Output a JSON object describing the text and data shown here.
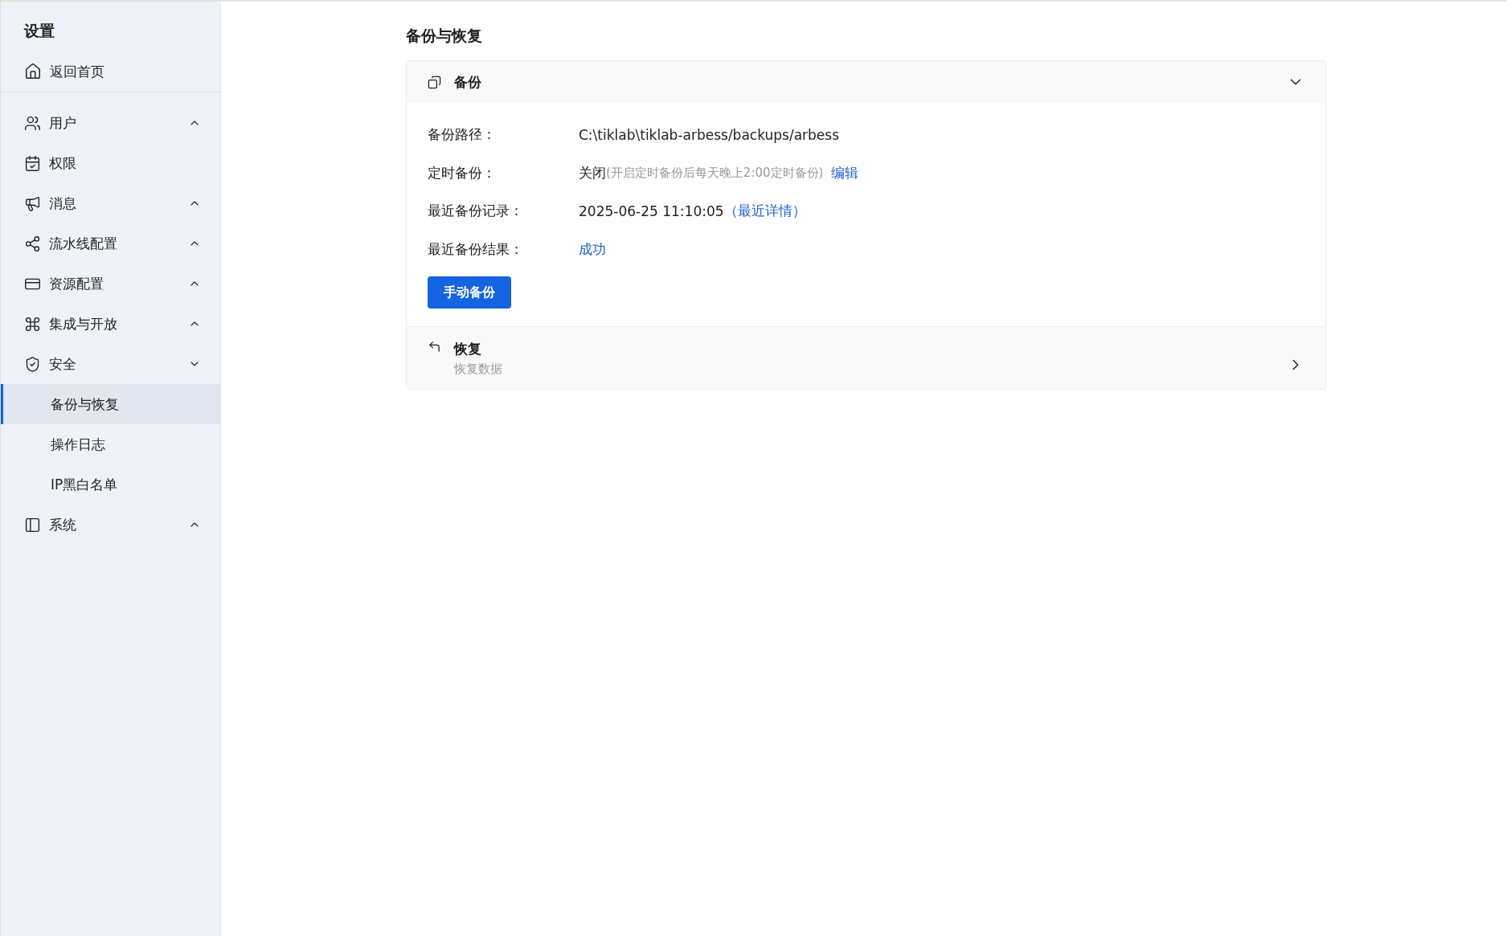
{
  "sidebar": {
    "title": "设置",
    "home": {
      "label": "返回首页"
    },
    "items": [
      {
        "label": "用户",
        "expanded": false
      },
      {
        "label": "权限"
      },
      {
        "label": "消息",
        "expanded": false
      },
      {
        "label": "流水线配置",
        "expanded": false
      },
      {
        "label": "资源配置",
        "expanded": false
      },
      {
        "label": "集成与开放",
        "expanded": false
      },
      {
        "label": "安全",
        "expanded": true,
        "children": [
          {
            "label": "备份与恢复",
            "selected": true
          },
          {
            "label": "操作日志",
            "selected": false
          },
          {
            "label": "IP黑白名单",
            "selected": false
          }
        ]
      },
      {
        "label": "系统",
        "expanded": false
      }
    ]
  },
  "page": {
    "title": "备份与恢复",
    "panels": [
      {
        "title": "备份",
        "expanded": true,
        "rows": [
          {
            "label": "备份路径：",
            "value": "C:\\tiklab\\tiklab-arbess/backups/arbess"
          },
          {
            "label": "定时备份：",
            "value": "关闭",
            "note": "(开启定时备份后每天晚上2:00定时备份)",
            "link": "编辑"
          },
          {
            "label": "最近备份记录：",
            "value": "2025-06-25 11:10:05",
            "link": "（最近详情）"
          },
          {
            "label": "最近备份结果：",
            "link": "成功"
          }
        ],
        "button": "手动备份"
      },
      {
        "title": "恢复",
        "subtitle": "恢复数据",
        "expanded": false
      }
    ]
  }
}
